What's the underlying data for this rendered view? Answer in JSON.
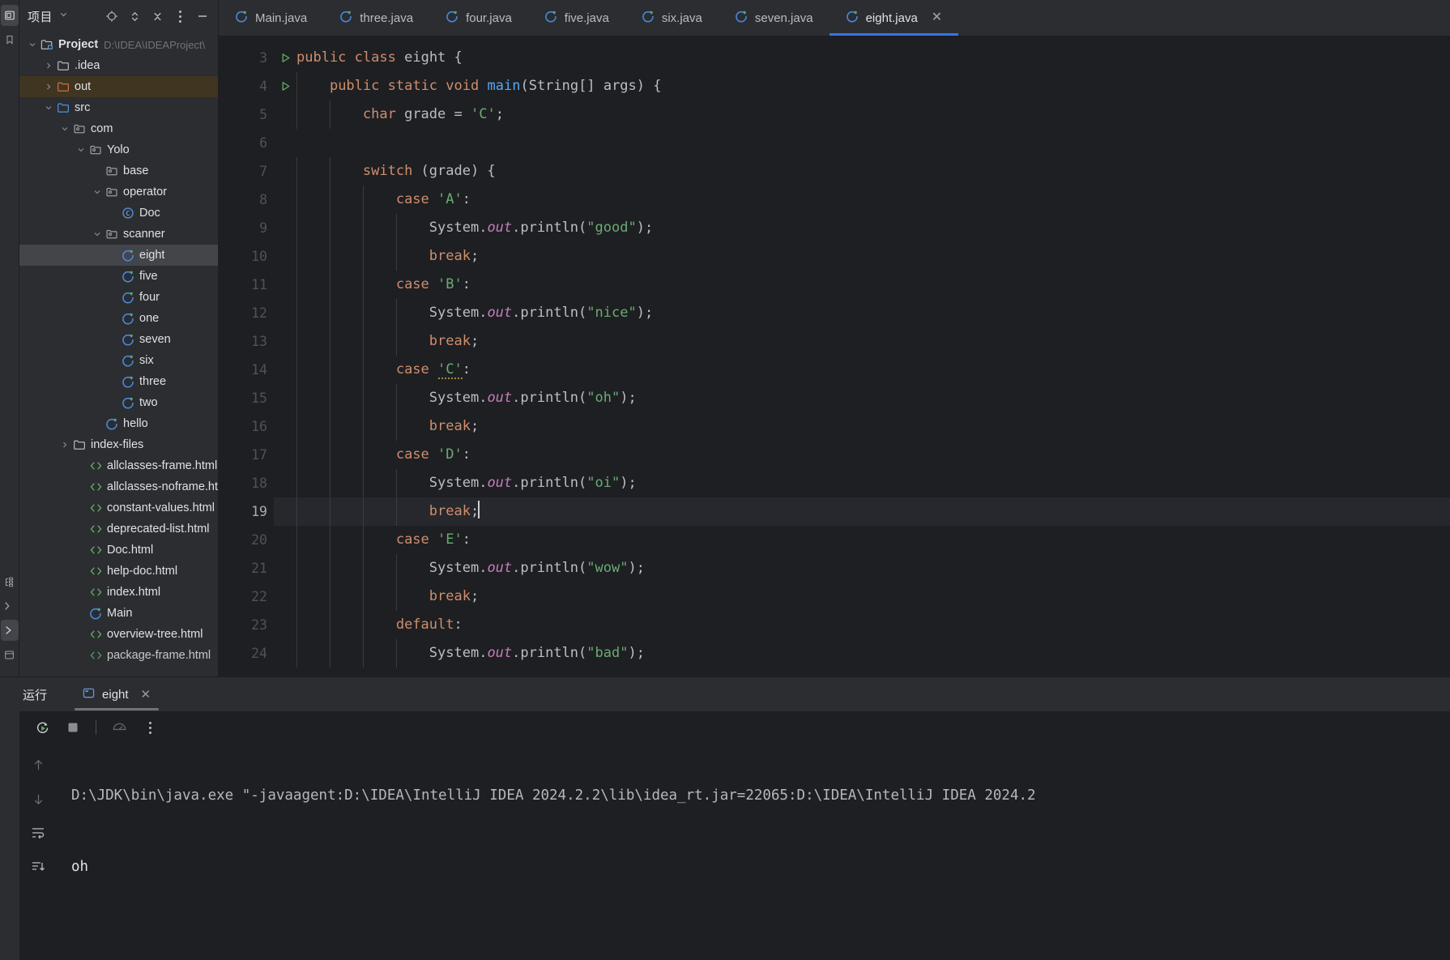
{
  "project_panel": {
    "title": "项目",
    "actions": [
      "select-opened-file-icon",
      "expand-collapse-icon",
      "collapse-all-icon",
      "more-options-icon",
      "hide-icon"
    ],
    "tree": [
      {
        "label": "Project",
        "sub": "D:\\IDEA\\IDEAProject\\",
        "icon": "project-folder-icon",
        "arrow": "down",
        "indent": 0,
        "bold": true,
        "state": "normal"
      },
      {
        "label": ".idea",
        "sub": "",
        "icon": "folder-icon",
        "arrow": "right",
        "indent": 1,
        "bold": false,
        "state": "normal"
      },
      {
        "label": "out",
        "sub": "",
        "icon": "folder-excluded-icon",
        "arrow": "right",
        "indent": 1,
        "bold": false,
        "state": "highlight-out"
      },
      {
        "label": "src",
        "sub": "",
        "icon": "source-folder-icon",
        "arrow": "down",
        "indent": 1,
        "bold": false,
        "state": "normal"
      },
      {
        "label": "com",
        "sub": "",
        "icon": "package-icon",
        "arrow": "down",
        "indent": 2,
        "bold": false,
        "state": "normal"
      },
      {
        "label": "Yolo",
        "sub": "",
        "icon": "package-icon",
        "arrow": "down",
        "indent": 3,
        "bold": false,
        "state": "normal"
      },
      {
        "label": "base",
        "sub": "",
        "icon": "package-icon",
        "arrow": "none",
        "indent": 4,
        "bold": false,
        "state": "normal"
      },
      {
        "label": "operator",
        "sub": "",
        "icon": "package-icon",
        "arrow": "down",
        "indent": 4,
        "bold": false,
        "state": "normal"
      },
      {
        "label": "Doc",
        "sub": "",
        "icon": "java-class-icon",
        "arrow": "none",
        "indent": 5,
        "bold": false,
        "state": "normal"
      },
      {
        "label": "scanner",
        "sub": "",
        "icon": "package-icon",
        "arrow": "down",
        "indent": 4,
        "bold": false,
        "state": "normal"
      },
      {
        "label": "eight",
        "sub": "",
        "icon": "java-runnable-class-icon",
        "arrow": "none",
        "indent": 5,
        "bold": false,
        "state": "selected"
      },
      {
        "label": "five",
        "sub": "",
        "icon": "java-runnable-class-icon",
        "arrow": "none",
        "indent": 5,
        "bold": false,
        "state": "normal"
      },
      {
        "label": "four",
        "sub": "",
        "icon": "java-runnable-class-icon",
        "arrow": "none",
        "indent": 5,
        "bold": false,
        "state": "normal"
      },
      {
        "label": "one",
        "sub": "",
        "icon": "java-runnable-class-icon",
        "arrow": "none",
        "indent": 5,
        "bold": false,
        "state": "normal"
      },
      {
        "label": "seven",
        "sub": "",
        "icon": "java-runnable-class-icon",
        "arrow": "none",
        "indent": 5,
        "bold": false,
        "state": "normal"
      },
      {
        "label": "six",
        "sub": "",
        "icon": "java-runnable-class-icon",
        "arrow": "none",
        "indent": 5,
        "bold": false,
        "state": "normal"
      },
      {
        "label": "three",
        "sub": "",
        "icon": "java-runnable-class-icon",
        "arrow": "none",
        "indent": 5,
        "bold": false,
        "state": "normal"
      },
      {
        "label": "two",
        "sub": "",
        "icon": "java-runnable-class-icon",
        "arrow": "none",
        "indent": 5,
        "bold": false,
        "state": "normal"
      },
      {
        "label": "hello",
        "sub": "",
        "icon": "java-runnable-class-icon",
        "arrow": "none",
        "indent": 4,
        "bold": false,
        "state": "normal"
      },
      {
        "label": "index-files",
        "sub": "",
        "icon": "folder-icon",
        "arrow": "right",
        "indent": 2,
        "bold": false,
        "state": "normal"
      },
      {
        "label": "allclasses-frame.html",
        "sub": "",
        "icon": "html-file-icon",
        "arrow": "none",
        "indent": 3,
        "bold": false,
        "state": "normal"
      },
      {
        "label": "allclasses-noframe.html",
        "sub": "",
        "icon": "html-file-icon",
        "arrow": "none",
        "indent": 3,
        "bold": false,
        "state": "normal"
      },
      {
        "label": "constant-values.html",
        "sub": "",
        "icon": "html-file-icon",
        "arrow": "none",
        "indent": 3,
        "bold": false,
        "state": "normal"
      },
      {
        "label": "deprecated-list.html",
        "sub": "",
        "icon": "html-file-icon",
        "arrow": "none",
        "indent": 3,
        "bold": false,
        "state": "normal"
      },
      {
        "label": "Doc.html",
        "sub": "",
        "icon": "html-file-icon",
        "arrow": "none",
        "indent": 3,
        "bold": false,
        "state": "normal"
      },
      {
        "label": "help-doc.html",
        "sub": "",
        "icon": "html-file-icon",
        "arrow": "none",
        "indent": 3,
        "bold": false,
        "state": "normal"
      },
      {
        "label": "index.html",
        "sub": "",
        "icon": "html-file-icon",
        "arrow": "none",
        "indent": 3,
        "bold": false,
        "state": "normal"
      },
      {
        "label": "Main",
        "sub": "",
        "icon": "java-runnable-class-icon",
        "arrow": "none",
        "indent": 3,
        "bold": false,
        "state": "normal"
      },
      {
        "label": "overview-tree.html",
        "sub": "",
        "icon": "html-file-icon",
        "arrow": "none",
        "indent": 3,
        "bold": false,
        "state": "normal"
      },
      {
        "label": "package-frame.html",
        "sub": "",
        "icon": "html-file-icon",
        "arrow": "none",
        "indent": 3,
        "bold": false,
        "state": "cut-off"
      }
    ]
  },
  "editor": {
    "tabs": [
      {
        "label": "Main.java",
        "active": false,
        "closable": false
      },
      {
        "label": "three.java",
        "active": false,
        "closable": false
      },
      {
        "label": "four.java",
        "active": false,
        "closable": false
      },
      {
        "label": "five.java",
        "active": false,
        "closable": false
      },
      {
        "label": "six.java",
        "active": false,
        "closable": false
      },
      {
        "label": "seven.java",
        "active": false,
        "closable": false
      },
      {
        "label": "eight.java",
        "active": true,
        "closable": true
      }
    ],
    "close_glyph": "✕",
    "first_line_number": 3,
    "current_line": 19,
    "run_marker_lines": [
      3,
      4
    ],
    "lines": [
      {
        "n": 3,
        "indent": 0,
        "tokens": [
          [
            "kw",
            "public"
          ],
          [
            "pl",
            " "
          ],
          [
            "kw",
            "class"
          ],
          [
            "pl",
            " "
          ],
          [
            "id",
            "eight"
          ],
          [
            "pl",
            " {"
          ]
        ]
      },
      {
        "n": 4,
        "indent": 1,
        "tokens": [
          [
            "kw",
            "public"
          ],
          [
            "pl",
            " "
          ],
          [
            "kw",
            "static"
          ],
          [
            "pl",
            " "
          ],
          [
            "kw",
            "void"
          ],
          [
            "pl",
            " "
          ],
          [
            "fn",
            "main"
          ],
          [
            "pl",
            "("
          ],
          [
            "id",
            "String"
          ],
          [
            "pl",
            "[] args) {"
          ]
        ]
      },
      {
        "n": 5,
        "indent": 2,
        "tokens": [
          [
            "kw",
            "char"
          ],
          [
            "pl",
            " grade = "
          ],
          [
            "str",
            "'C'"
          ],
          [
            "pl",
            ";"
          ]
        ]
      },
      {
        "n": 6,
        "indent": 0,
        "tokens": []
      },
      {
        "n": 7,
        "indent": 2,
        "tokens": [
          [
            "kw",
            "switch"
          ],
          [
            "pl",
            " (grade) {"
          ]
        ]
      },
      {
        "n": 8,
        "indent": 3,
        "tokens": [
          [
            "kw",
            "case"
          ],
          [
            "pl",
            " "
          ],
          [
            "str",
            "'A'"
          ],
          [
            "pl",
            ":"
          ]
        ]
      },
      {
        "n": 9,
        "indent": 4,
        "tokens": [
          [
            "id",
            "System"
          ],
          [
            "pl",
            "."
          ],
          [
            "fld",
            "out"
          ],
          [
            "pl",
            ".println("
          ],
          [
            "str",
            "\"good\""
          ],
          [
            "pl",
            ");"
          ]
        ]
      },
      {
        "n": 10,
        "indent": 4,
        "tokens": [
          [
            "kw",
            "break"
          ],
          [
            "pl",
            ";"
          ]
        ]
      },
      {
        "n": 11,
        "indent": 3,
        "tokens": [
          [
            "kw",
            "case"
          ],
          [
            "pl",
            " "
          ],
          [
            "str",
            "'B'"
          ],
          [
            "pl",
            ":"
          ]
        ]
      },
      {
        "n": 12,
        "indent": 4,
        "tokens": [
          [
            "id",
            "System"
          ],
          [
            "pl",
            "."
          ],
          [
            "fld",
            "out"
          ],
          [
            "pl",
            ".println("
          ],
          [
            "str",
            "\"nice\""
          ],
          [
            "pl",
            ");"
          ]
        ]
      },
      {
        "n": 13,
        "indent": 4,
        "tokens": [
          [
            "kw",
            "break"
          ],
          [
            "pl",
            ";"
          ]
        ]
      },
      {
        "n": 14,
        "indent": 3,
        "tokens": [
          [
            "kw",
            "case"
          ],
          [
            "pl",
            " "
          ],
          [
            "warn",
            "'C'"
          ],
          [
            "pl",
            ":"
          ]
        ]
      },
      {
        "n": 15,
        "indent": 4,
        "tokens": [
          [
            "id",
            "System"
          ],
          [
            "pl",
            "."
          ],
          [
            "fld",
            "out"
          ],
          [
            "pl",
            ".println("
          ],
          [
            "str",
            "\"oh\""
          ],
          [
            "pl",
            ");"
          ]
        ]
      },
      {
        "n": 16,
        "indent": 4,
        "tokens": [
          [
            "kw",
            "break"
          ],
          [
            "pl",
            ";"
          ]
        ]
      },
      {
        "n": 17,
        "indent": 3,
        "tokens": [
          [
            "kw",
            "case"
          ],
          [
            "pl",
            " "
          ],
          [
            "str",
            "'D'"
          ],
          [
            "pl",
            ":"
          ]
        ]
      },
      {
        "n": 18,
        "indent": 4,
        "tokens": [
          [
            "id",
            "System"
          ],
          [
            "pl",
            "."
          ],
          [
            "fld",
            "out"
          ],
          [
            "pl",
            ".println("
          ],
          [
            "str",
            "\"oi\""
          ],
          [
            "pl",
            ");"
          ]
        ]
      },
      {
        "n": 19,
        "indent": 4,
        "tokens": [
          [
            "kw",
            "break"
          ],
          [
            "pl",
            ";"
          ],
          [
            "caret",
            ""
          ]
        ]
      },
      {
        "n": 20,
        "indent": 3,
        "tokens": [
          [
            "kw",
            "case"
          ],
          [
            "pl",
            " "
          ],
          [
            "str",
            "'E'"
          ],
          [
            "pl",
            ":"
          ]
        ]
      },
      {
        "n": 21,
        "indent": 4,
        "tokens": [
          [
            "id",
            "System"
          ],
          [
            "pl",
            "."
          ],
          [
            "fld",
            "out"
          ],
          [
            "pl",
            ".println("
          ],
          [
            "str",
            "\"wow\""
          ],
          [
            "pl",
            ");"
          ]
        ]
      },
      {
        "n": 22,
        "indent": 4,
        "tokens": [
          [
            "kw",
            "break"
          ],
          [
            "pl",
            ";"
          ]
        ]
      },
      {
        "n": 23,
        "indent": 3,
        "tokens": [
          [
            "kw",
            "default"
          ],
          [
            "pl",
            ":"
          ]
        ]
      },
      {
        "n": 24,
        "indent": 4,
        "tokens": [
          [
            "id",
            "System"
          ],
          [
            "pl",
            "."
          ],
          [
            "fld",
            "out"
          ],
          [
            "pl",
            ".println("
          ],
          [
            "str",
            "\"bad\""
          ],
          [
            "pl",
            ");"
          ]
        ]
      }
    ]
  },
  "run_panel": {
    "title": "运行",
    "tab_label": "eight",
    "tab_close_glyph": "✕",
    "actions": [
      "rerun-icon",
      "stop-icon",
      "profiler-icon",
      "more-options-icon"
    ],
    "side_actions": [
      "scroll-up-icon",
      "scroll-down-icon",
      "soft-wrap-icon",
      "scroll-to-end-icon"
    ],
    "console": {
      "command": "D:\\JDK\\bin\\java.exe \"-javaagent:D:\\IDEA\\IntelliJ IDEA 2024.2.2\\lib\\idea_rt.jar=22065:D:\\IDEA\\IntelliJ IDEA 2024.2",
      "output": "oh"
    }
  },
  "left_strip": {
    "icons": [
      "project-tool-window-icon",
      "bookmarks-icon"
    ]
  },
  "left_bottom_strip": {
    "icons": [
      "structure-icon",
      "terminal-icon",
      "run-tool-window-icon",
      "services-icon"
    ]
  },
  "colors": {
    "accent_blue": "#3574f0",
    "keyword_orange": "#cf8e6d",
    "string_green": "#6aab73",
    "method_blue": "#56a8f5",
    "field_purple": "#c77dbb",
    "panel_bg": "#2b2d30",
    "editor_bg": "#1e1f22",
    "selection_gray": "#43454a",
    "excluded_folder": "#3f3521"
  }
}
